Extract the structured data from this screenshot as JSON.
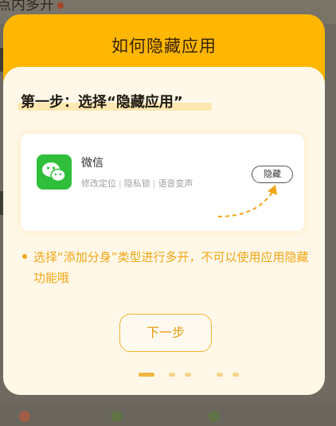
{
  "dialog": {
    "title": "如何隐藏应用",
    "step_title": "第一步：选择“隐藏应用”",
    "card": {
      "app_name": "微信",
      "tags": [
        "修改定位",
        "隐私锁",
        "语音变声"
      ],
      "hide_label": "隐藏"
    },
    "note": "选择“添加分身”类型进行多开，不可以使用应用隐藏功能哦",
    "next_label": "下一步",
    "pager": {
      "total": 5,
      "current": 1
    }
  },
  "colors": {
    "header": "#ffb703",
    "body": "#fff8e8",
    "accent": "#f2a516",
    "app_icon": "#2fbf3a"
  },
  "icons": {
    "app": "wechat-icon",
    "arrow": "dashed-curved-arrow-icon"
  }
}
